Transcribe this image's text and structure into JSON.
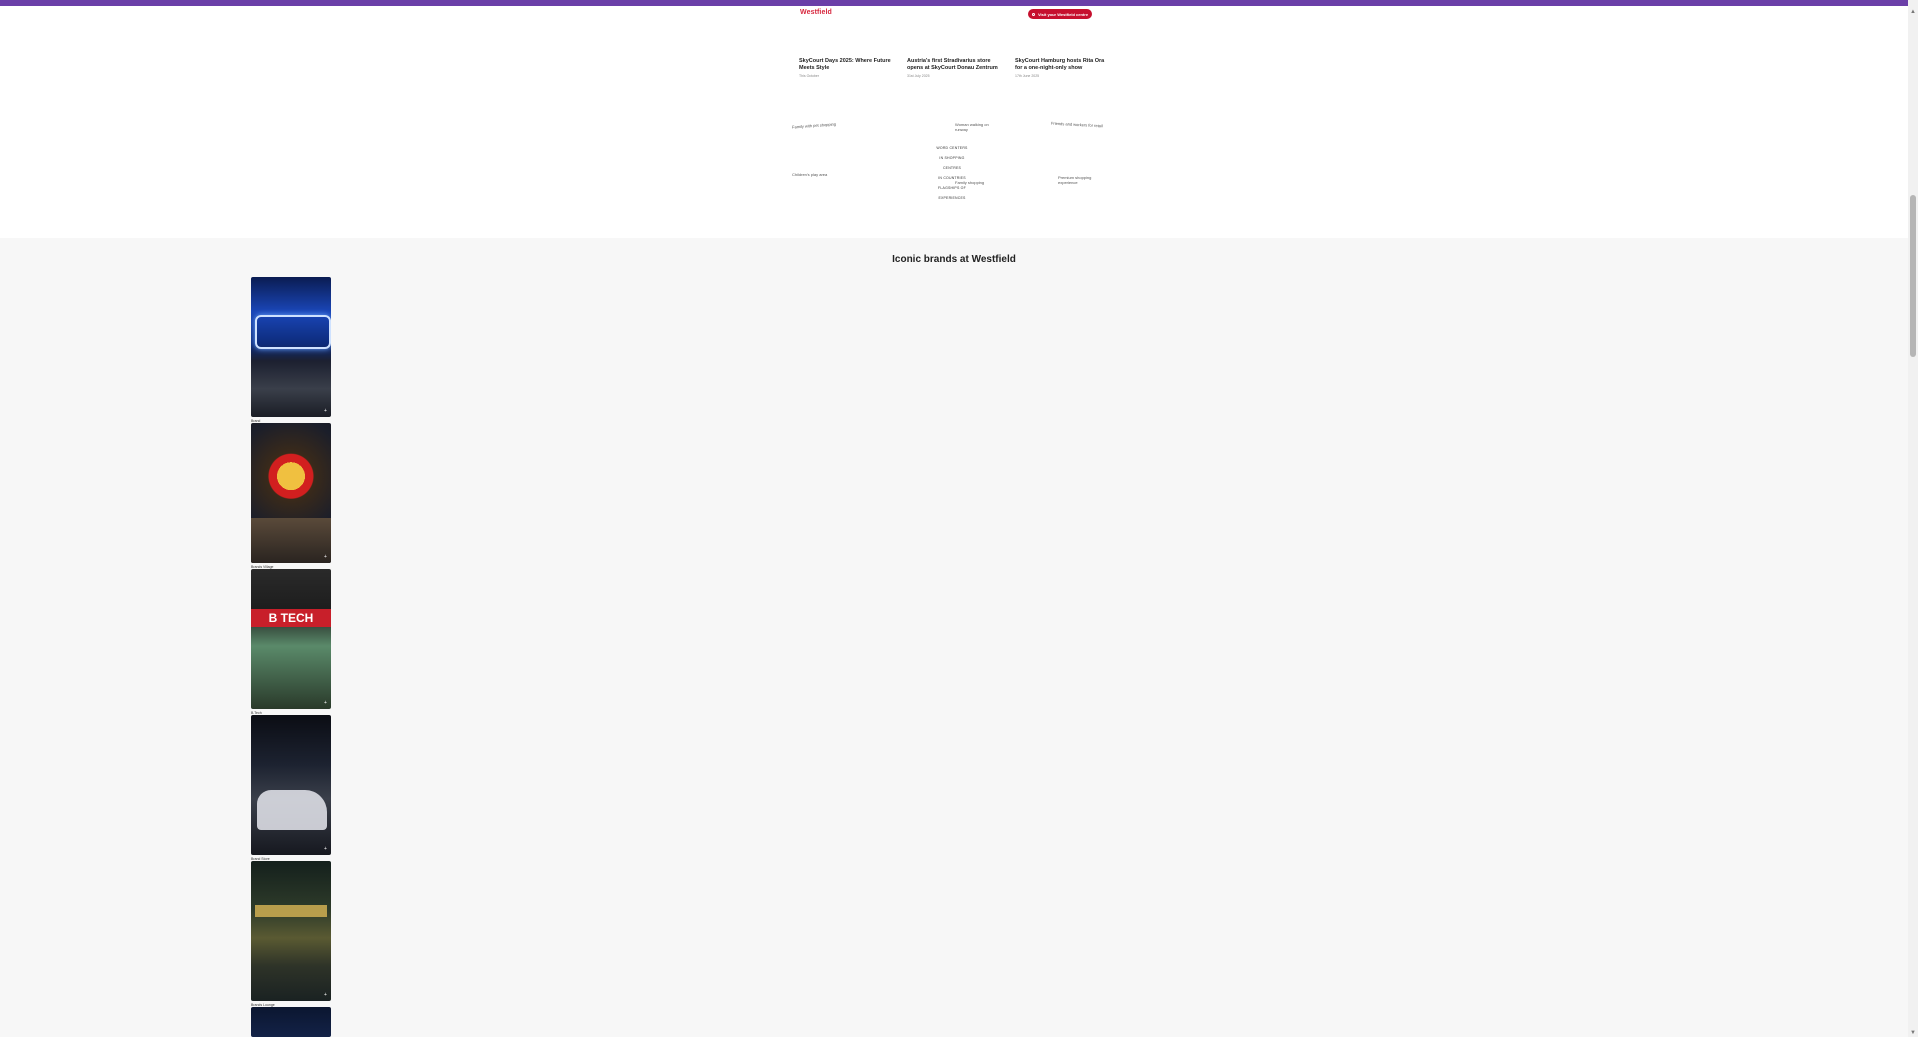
{
  "header": {
    "logo_text": "Westfield",
    "cta_label": "Visit your Westfield centre"
  },
  "news": [
    {
      "title": "SkyCourt Days 2025: Where Future Meets Style",
      "date": "This October"
    },
    {
      "title": "Austria's first Stradivarius store opens at SkyCourt Donau Zentrum",
      "date": "31st July 2025"
    },
    {
      "title": "SkyCourt Hamburg hosts Rita Ora for a one-night-only show",
      "date": "17th June 2025"
    }
  ],
  "image_alts": {
    "family": "Family with pet shopping",
    "woman": "Woman walking on runway",
    "friends": "Friends and workers for retail",
    "children": "Children's play area",
    "premium": "Premium shopping experience",
    "family2": "Family shopping"
  },
  "stats": [
    "WORD CENTERS",
    "IN SHOPPING",
    "CENTRES",
    "IN COUNTRIES",
    "FLAGSHIPS OF",
    "EXPERIENCES"
  ],
  "brands": {
    "heading": "Iconic brands at Westfield",
    "items": [
      {
        "name": "Brand",
        "sign": ""
      },
      {
        "name": "Brands Village",
        "sign": ""
      },
      {
        "name": "B.Tech",
        "sign": "B TECH"
      },
      {
        "name": "Brand Store",
        "sign": ""
      },
      {
        "name": "Brands Lounge",
        "sign": ""
      },
      {
        "name": "",
        "sign": ""
      }
    ]
  },
  "colors": {
    "accent": "#c6102e",
    "top_bar": "#6b3fa8",
    "logo": "#d7263d",
    "section_bg": "#f7f7f7"
  },
  "icons": {
    "cta": "location-pin-icon",
    "card_expand": "plus-icon",
    "scroll_up": "chevron-up-icon",
    "scroll_down": "chevron-down-icon"
  }
}
